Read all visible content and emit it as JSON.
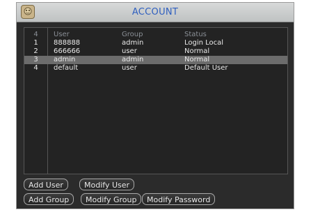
{
  "window": {
    "title": "ACCOUNT"
  },
  "table": {
    "header": {
      "num": "4",
      "user": "User",
      "group": "Group",
      "status": "Status"
    },
    "rows": [
      {
        "num": "1",
        "user": "888888",
        "group": "admin",
        "status": "Login Local"
      },
      {
        "num": "2",
        "user": "666666",
        "group": "user",
        "status": "Normal"
      },
      {
        "num": "3",
        "user": "admin",
        "group": "admin",
        "status": "Normal"
      },
      {
        "num": "4",
        "user": "default",
        "group": "user",
        "status": "Default User"
      }
    ],
    "selected_row": "3"
  },
  "buttons": {
    "add_user": "Add User",
    "modify_user": "Modify User",
    "add_group": "Add Group",
    "modify_group": "Modify Group",
    "modify_password": "Modify Password"
  },
  "colors": {
    "title": "#2f5fbf",
    "panel": "#232323",
    "selected_row": "#6c6c6c",
    "header_text": "#8a8f96"
  }
}
